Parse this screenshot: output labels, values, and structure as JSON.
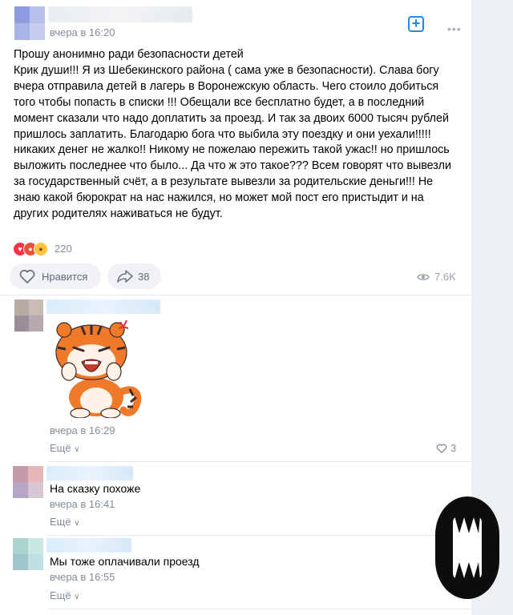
{
  "post": {
    "time": "вчера в 16:20",
    "text": "Прошу анонимно ради безопасности детей\nКрик души!!! Я из Шебекинского района ( сама уже в безопасности). Слава богу вчера отправила детей в лагерь в Воронежскую область. Чего стоило добиться того чтобы попасть в списки !!! Обещали все бесплатно будет, а в последний момент сказали что надо доплатить за проезд. И так за двоих 6000 тысяч рублей пришлось заплатить. Благодарю бога что выбила эту поездку и они уехали!!!!!никаких денег не жалко!! Никому не пожелаю пережить такой ужас!! но пришлось выложить последнее что было... Да что ж это такое??? Всем говорят что вывезли за государственный счёт, а в результате вывезли за родительские деньги!!! Не знаю какой бюрократ на нас нажился, но может мой пост его пристыдит и на других родителях наживаться не будут.",
    "reactions_count": "220",
    "like_label": "Нравится",
    "share_count": "38",
    "views": "7.6K"
  },
  "comments": [
    {
      "time": "вчера в 16:29",
      "more": "Ещё",
      "likes": "3",
      "sticker": "tiger-sticker"
    },
    {
      "text": "На сказку похоже",
      "time": "вчера в 16:41",
      "more": "Ещё"
    },
    {
      "text": "Мы тоже оплачивали проезд",
      "time": "вчера в 16:55",
      "more": "Ещё"
    }
  ],
  "colors": {
    "accent": "#2688eb",
    "secondary": "#818c99"
  }
}
